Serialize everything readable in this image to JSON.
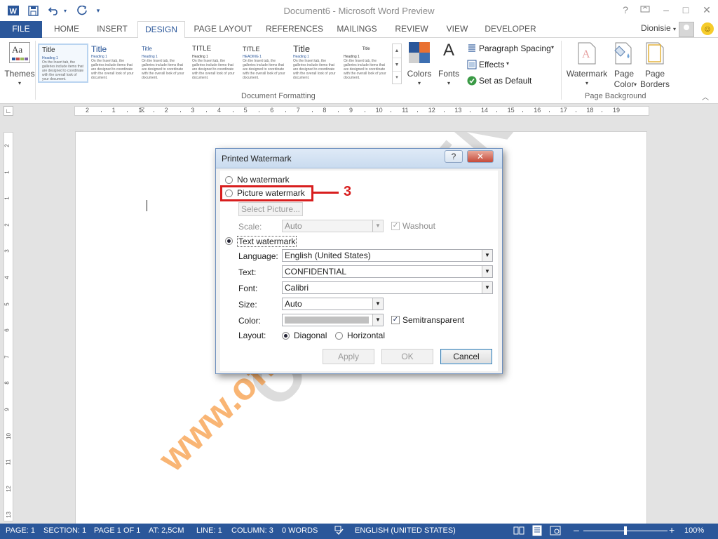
{
  "titlebar": {
    "title": "Document6 - Microsoft Word Preview",
    "help": "?",
    "minimize": "–",
    "maximize": "□",
    "close": "✕"
  },
  "tabs": {
    "file": "FILE",
    "items": [
      "HOME",
      "INSERT",
      "DESIGN",
      "PAGE LAYOUT",
      "REFERENCES",
      "MAILINGS",
      "REVIEW",
      "VIEW",
      "DEVELOPER"
    ],
    "active": "DESIGN",
    "account": "Dionisie"
  },
  "ribbon": {
    "themes_label": "Themes",
    "styles": [
      {
        "title": "Title",
        "heading": "Heading 1"
      },
      {
        "title": "Title",
        "heading": "Heading 1"
      },
      {
        "title": "Title",
        "heading": "Heading 1"
      },
      {
        "title": "TITLE",
        "heading": "Heading 1"
      },
      {
        "title": "TITLE",
        "heading": "HEADING 1"
      },
      {
        "title": "Title",
        "heading": "Heading 1"
      },
      {
        "title": "Title",
        "heading": "Heading 1"
      }
    ],
    "style_sample_text": "On the Insert tab, the galleries include items that are designed to coordinate with the overall look of your document.",
    "document_formatting_label": "Document Formatting",
    "colors_label": "Colors",
    "fonts_label": "Fonts",
    "fonts_glyph": "A",
    "paragraph_spacing_label": "Paragraph Spacing",
    "effects_label": "Effects",
    "set_default_label": "Set as Default",
    "watermark_label": "Watermark",
    "page_color_label": "Page Color",
    "page_borders_label": "Page Borders",
    "page_background_label": "Page Background"
  },
  "ruler": {
    "marks": [
      "2",
      "1",
      "1",
      "2",
      "3",
      "4",
      "5",
      "6",
      "7",
      "8",
      "9",
      "10",
      "11",
      "12",
      "13",
      "14",
      "15",
      "16",
      "17",
      "18",
      "19"
    ],
    "vmarks": [
      "2",
      "1",
      "1",
      "2",
      "3",
      "4",
      "5",
      "6",
      "7",
      "8",
      "9",
      "10",
      "11",
      "12",
      "13"
    ]
  },
  "document": {
    "watermark_preview_text": "CONFIDENTIAL"
  },
  "overlay": {
    "site_watermark": "www.office-learning.ro",
    "callout_number": "3"
  },
  "dialog": {
    "title": "Printed Watermark",
    "help_btn": "?",
    "close_btn": "✕",
    "no_watermark": "No watermark",
    "picture_watermark": "Picture watermark",
    "select_picture": "Select Picture...",
    "scale_label": "Scale:",
    "scale_value": "Auto",
    "washout_label": "Washout",
    "text_watermark": "Text watermark",
    "language_label": "Language:",
    "language_value": "English (United States)",
    "text_label": "Text:",
    "text_value": "CONFIDENTIAL",
    "font_label": "Font:",
    "font_value": "Calibri",
    "size_label": "Size:",
    "size_value": "Auto",
    "color_label": "Color:",
    "color_value": "#c0c0c0",
    "semitransparent_label": "Semitransparent",
    "layout_label": "Layout:",
    "diagonal_label": "Diagonal",
    "horizontal_label": "Horizontal",
    "apply": "Apply",
    "ok": "OK",
    "cancel": "Cancel",
    "selected_option": "text_watermark"
  },
  "statusbar": {
    "page": "PAGE: 1",
    "section": "SECTION: 1",
    "page_of": "PAGE 1 OF 1",
    "at": "AT: 2,5CM",
    "line": "LINE: 1",
    "column": "COLUMN: 3",
    "words": "0 WORDS",
    "language": "ENGLISH (UNITED STATES)",
    "zoom": "100%"
  },
  "colors": {
    "accent": "#2b579a",
    "callout": "#d81e1e",
    "site_watermark": "#f7993e"
  }
}
